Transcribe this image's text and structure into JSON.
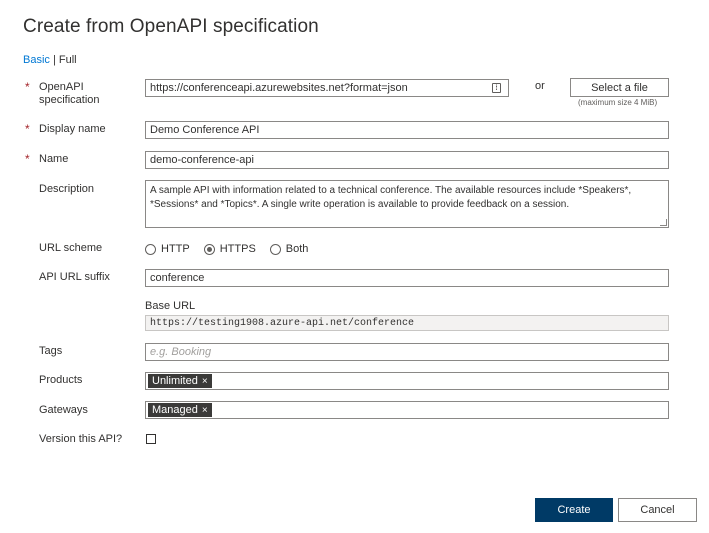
{
  "page_title": "Create from OpenAPI specification",
  "modes": {
    "basic": "Basic",
    "separator": " | ",
    "full": "Full"
  },
  "required_marker": "*",
  "fields": {
    "openapi_spec": {
      "label_line1": "OpenAPI",
      "label_line2": "specification",
      "value": "https://conferenceapi.azurewebsites.net?format=json",
      "icon": "clipboard-icon"
    },
    "or_text": "or",
    "select_file": {
      "label": "Select a file",
      "note": "(maximum size 4 MiB)"
    },
    "display_name": {
      "label": "Display name",
      "value": "Demo Conference API"
    },
    "name": {
      "label": "Name",
      "value": "demo-conference-api"
    },
    "description": {
      "label": "Description",
      "value": "A sample API with information related to a technical conference.  The available resources  include *Speakers*, *Sessions* and *Topics*.  A single write operation is available to provide  feedback on a session."
    },
    "url_scheme": {
      "label": "URL scheme",
      "options": [
        "HTTP",
        "HTTPS",
        "Both"
      ],
      "selected": "HTTPS"
    },
    "api_url_suffix": {
      "label": "API URL suffix",
      "value": "conference"
    },
    "base_url": {
      "label": "Base URL",
      "value": "https://testing1908.azure-api.net/conference"
    },
    "tags": {
      "label": "Tags",
      "placeholder": "e.g. Booking"
    },
    "products": {
      "label": "Products",
      "chips": [
        "Unlimited"
      ],
      "chip_remove": "×"
    },
    "gateways": {
      "label": "Gateways",
      "chips": [
        "Managed"
      ],
      "chip_remove": "×"
    },
    "versioning": {
      "label": "Version this API?",
      "checked": false
    }
  },
  "buttons": {
    "create": "Create",
    "cancel": "Cancel"
  },
  "colors": {
    "primary": "#003a66",
    "link": "#0078d4",
    "required": "#a4262c",
    "chip": "#3b3a39"
  }
}
